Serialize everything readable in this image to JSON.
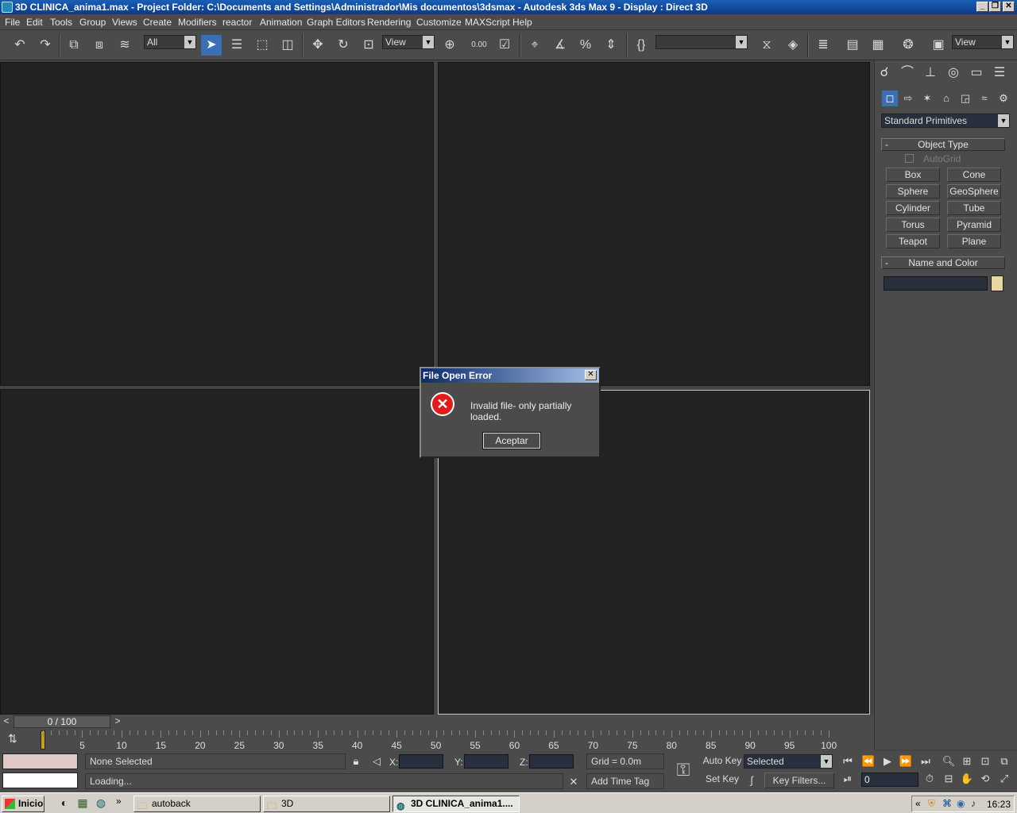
{
  "window": {
    "title": "3D CLINICA_anima1.max    - Project Folder: C:\\Documents and Settings\\Administrador\\Mis documentos\\3dsmax    - Autodesk 3ds Max 9     - Display : Direct 3D",
    "min": "_",
    "max": "❐",
    "close": "✕"
  },
  "menu": [
    "File",
    "Edit",
    "Tools",
    "Group",
    "Views",
    "Create",
    "Modifiers",
    "reactor",
    "Animation",
    "Graph Editors",
    "Rendering",
    "Customize",
    "MAXScript",
    "Help"
  ],
  "toolbar": {
    "filter_value": "All",
    "refcoord_value": "View",
    "named_selection_value": "",
    "view_dropdown_value": "View",
    "percent_snap_label": "0.00"
  },
  "command_panel": {
    "category_value": "Standard Primitives",
    "object_type_title": "Object Type",
    "autogrid_label": "AutoGrid",
    "primitives": [
      "Box",
      "Cone",
      "Sphere",
      "GeoSphere",
      "Cylinder",
      "Tube",
      "Torus",
      "Pyramid",
      "Teapot",
      "Plane"
    ],
    "name_color_title": "Name and Color",
    "object_color": "#e8d8a0"
  },
  "dialog": {
    "title": "File Open Error",
    "message": "Invalid file- only partially loaded.",
    "ok_label": "Aceptar",
    "close": "✕",
    "icon_glyph": "✕"
  },
  "timeline": {
    "frame_display": "0 / 100",
    "prev": "<",
    "next": ">",
    "ticks": [
      "5",
      "10",
      "15",
      "20",
      "25",
      "30",
      "35",
      "40",
      "45",
      "50",
      "55",
      "60",
      "65",
      "70",
      "75",
      "80",
      "85",
      "90",
      "95",
      "100"
    ]
  },
  "status": {
    "selection": "None Selected",
    "prompt": "Loading...",
    "x_label": "X:",
    "y_label": "Y:",
    "z_label": "Z:",
    "grid": "Grid = 0.0m",
    "add_time_tag": "Add Time Tag",
    "auto_key": "Auto Key",
    "set_key": "Set Key",
    "key_mode_value": "Selected",
    "key_filters": "Key Filters...",
    "current_frame": "0"
  },
  "taskbar": {
    "start": "Inicio",
    "tasks": [
      "autoback",
      "3D",
      "3D CLINICA_anima1...."
    ],
    "clock": "16:23",
    "chevron": "»",
    "tray_chevron": "«"
  },
  "colors": {
    "viewport_bg": "#222222",
    "ui_gray": "#4b4b4b",
    "accent_blue": "#3a6fb8"
  }
}
